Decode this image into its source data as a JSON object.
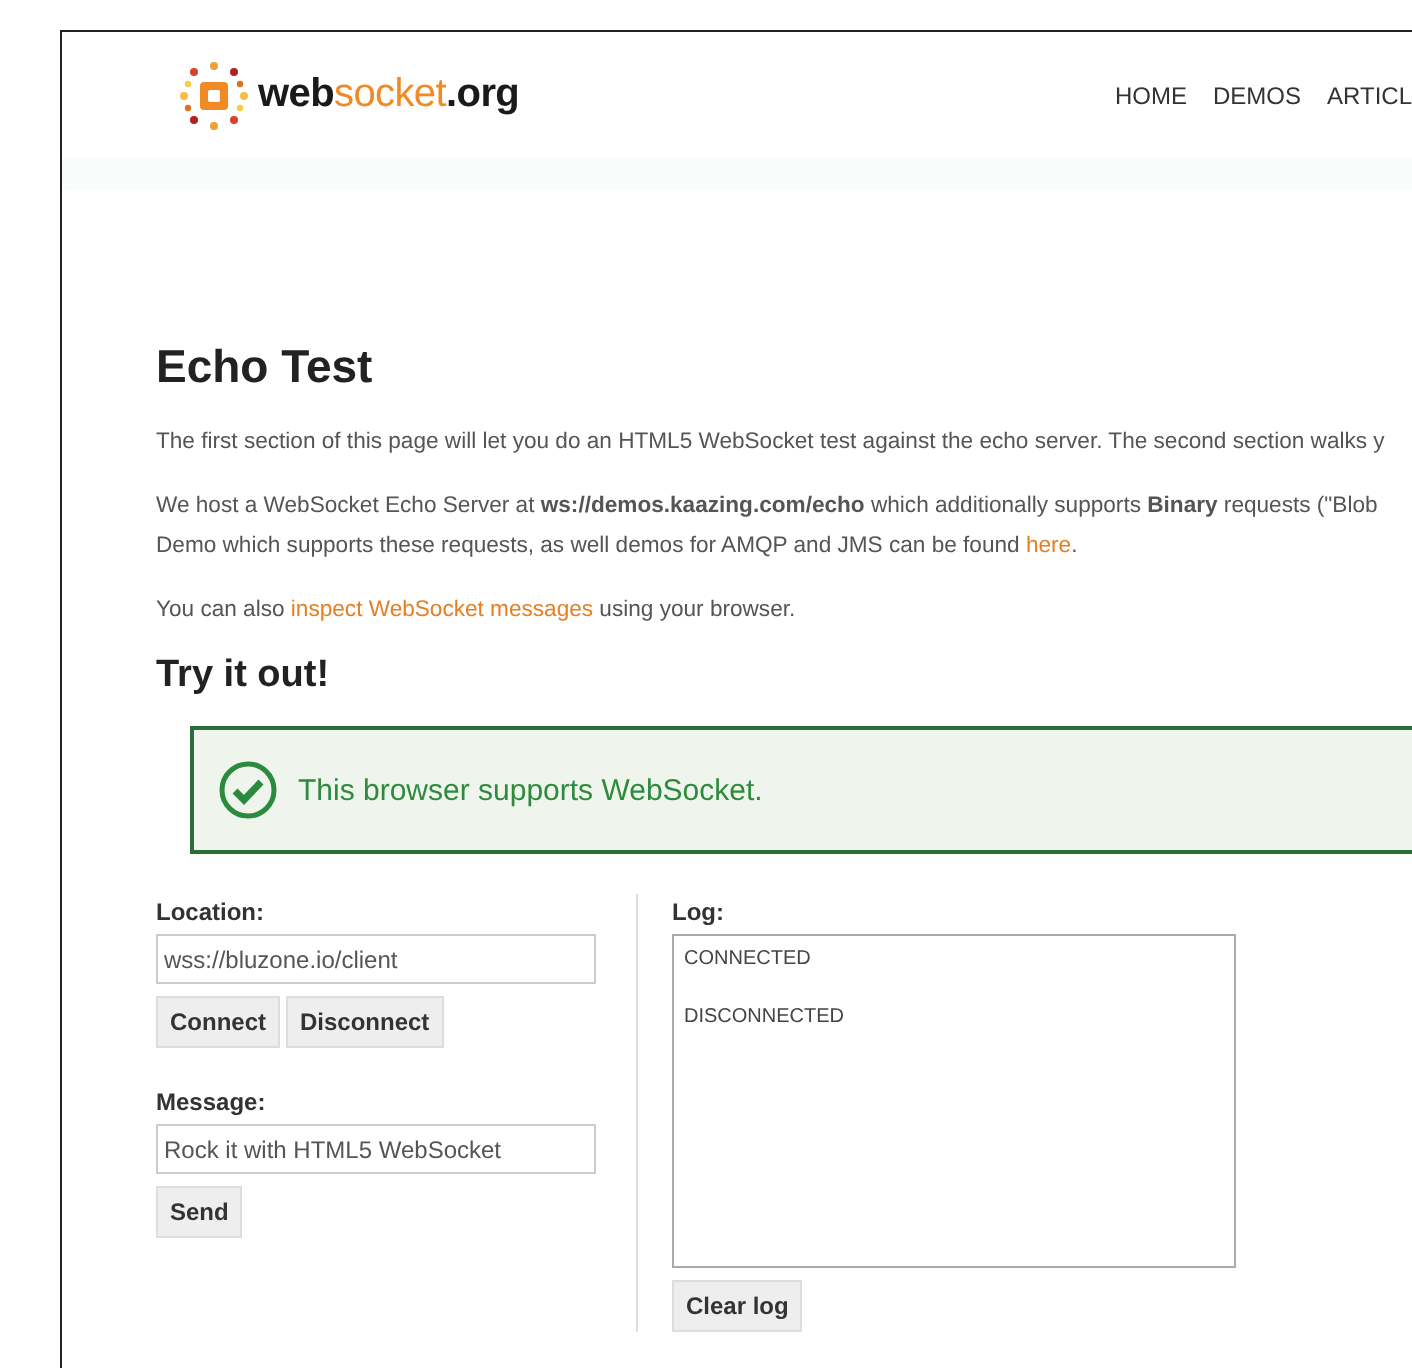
{
  "logo": {
    "pre": "web",
    "accent": "socket",
    "post": ".org"
  },
  "nav": [
    {
      "label": "HOME"
    },
    {
      "label": "DEMOS"
    },
    {
      "label": "ARTICL"
    }
  ],
  "title": "Echo Test",
  "paragraphs": [
    {
      "lines": [
        [
          {
            "kind": "text",
            "text": "The first section of this page will let you do an HTML5 WebSocket test against the echo server. The second section walks y"
          }
        ]
      ]
    },
    {
      "lines": [
        [
          {
            "kind": "text",
            "text": "We host a WebSocket Echo Server at **ws://demos.kaazing.com/echo** which additionally supports **Binary** requests (\"Blob"
          }
        ],
        [
          {
            "kind": "text",
            "text": "Demo which supports these requests, as well demos for AMQP and JMS can be found "
          },
          {
            "kind": "link",
            "text": "here"
          },
          {
            "kind": "text",
            "text": "."
          }
        ]
      ]
    },
    {
      "lines": [
        [
          {
            "kind": "text",
            "text": "You can also "
          },
          {
            "kind": "link",
            "text": "inspect WebSocket messages"
          },
          {
            "kind": "text",
            "text": " using your browser."
          }
        ]
      ]
    }
  ],
  "subtitle": "Try it out!",
  "notice": {
    "text": "This browser supports WebSocket.",
    "supported": true
  },
  "location": {
    "label": "Location:",
    "value": "wss://bluzone.io/client",
    "buttons": [
      "Connect",
      "Disconnect"
    ]
  },
  "message": {
    "label": "Message:",
    "value": "Rock it with HTML5 WebSocket",
    "buttons": [
      "Send"
    ]
  },
  "log": {
    "label": "Log:",
    "entries": [
      "CONNECTED",
      "DISCONNECTED"
    ],
    "button": "Clear log"
  }
}
